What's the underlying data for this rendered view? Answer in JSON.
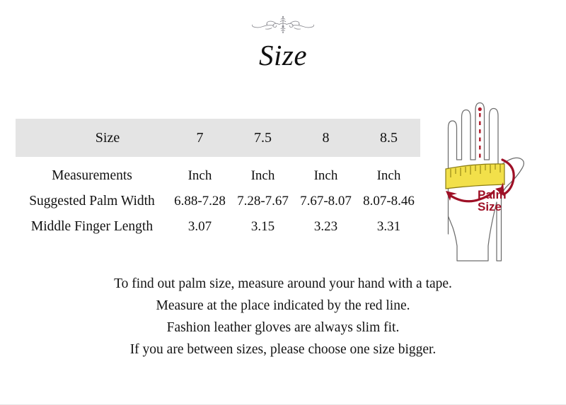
{
  "page": {
    "title": "Size",
    "ornament_icon": "flourish-ornament-icon"
  },
  "size_chart": {
    "header": {
      "label": "Size",
      "sizes": [
        "7",
        "7.5",
        "8",
        "8.5"
      ]
    },
    "rows": [
      {
        "label": "Measurements",
        "values": [
          "Inch",
          "Inch",
          "Inch",
          "Inch"
        ]
      },
      {
        "label": "Suggested Palm Width",
        "values": [
          "6.88-7.28",
          "7.28-7.67",
          "7.67-8.07",
          "8.07-8.46"
        ]
      },
      {
        "label": "Middle Finger Length",
        "values": [
          "3.07",
          "3.15",
          "3.23",
          "3.31"
        ]
      }
    ]
  },
  "diagram": {
    "name": "hand-measurement-diagram",
    "palm_size_label_line1": "Palm",
    "palm_size_label_line2": "Size",
    "tape_color": "#f2e04a",
    "tape_border_color": "#8a7c12",
    "arrow_color": "#9e1026",
    "dashed_line_color": "#b01f2e",
    "hand_outline_color": "#6e6e6e"
  },
  "instructions": [
    "To find out palm size, measure around your hand with a tape.",
    "Measure at the place indicated by the red line.",
    "Fashion leather gloves are always slim fit.",
    "If you are between sizes, please choose one size bigger."
  ],
  "colors": {
    "header_background": "#e4e4e4",
    "text": "#111111",
    "accent_red": "#9e1026",
    "tape_yellow": "#f2e04a"
  }
}
